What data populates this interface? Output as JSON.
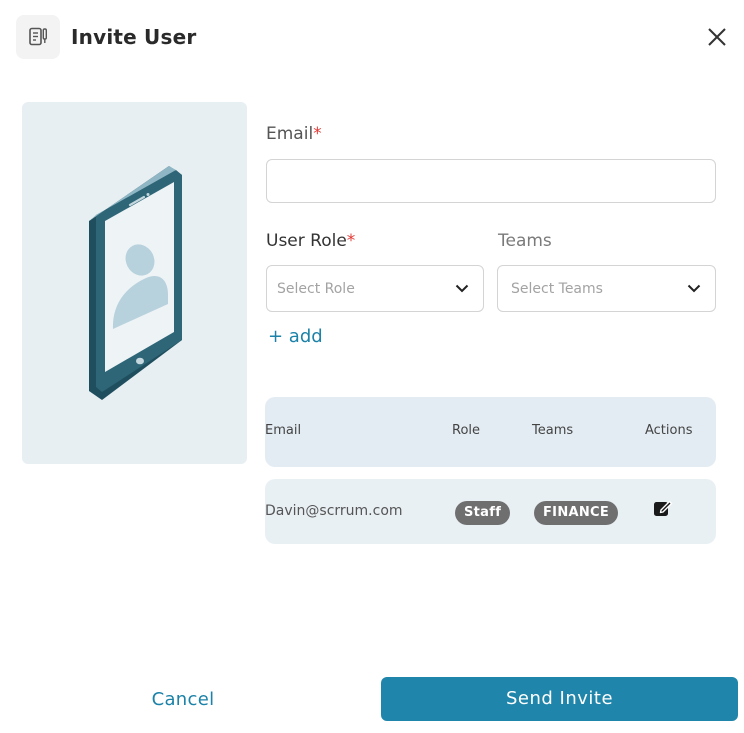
{
  "dialog": {
    "title": "Invite User",
    "header_icon": "invite-document-icon",
    "close_icon": "close-icon"
  },
  "illustration": {
    "icon": "tablet-user-illustration",
    "colors": {
      "background": "#e8eff3",
      "device": "#2e6677",
      "screen": "#eef3f6",
      "avatar": "#b8d2dd"
    }
  },
  "form": {
    "email": {
      "label": "Email",
      "required_mark": "*",
      "value": "",
      "placeholder": ""
    },
    "user_role": {
      "label": "User Role",
      "required_mark": "*",
      "placeholder": "Select Role"
    },
    "teams": {
      "label": "Teams",
      "placeholder": "Select Teams"
    },
    "add_link": "+ add"
  },
  "table": {
    "headers": [
      "Email",
      "Role",
      "Teams",
      "Actions"
    ],
    "rows": [
      {
        "email": "Davin@scrrum.com",
        "role": "Staff",
        "team": "FINANCE",
        "action_icon": "edit-icon"
      }
    ]
  },
  "footer": {
    "cancel_label": "Cancel",
    "send_label": "Send Invite"
  },
  "colors": {
    "accent": "#1f85aa",
    "required": "#e53935",
    "table_header_bg": "#e3ecf2",
    "pill_bg": "#6f6f6f"
  }
}
